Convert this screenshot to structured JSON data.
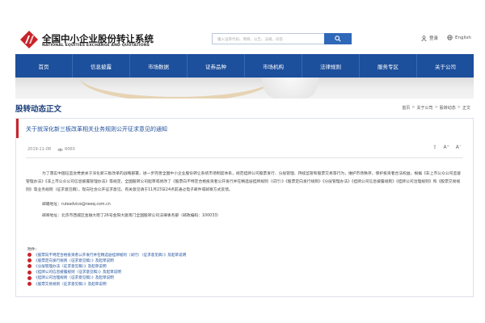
{
  "header": {
    "logo_cn": "全国中小企业股份转让系统",
    "logo_en": "NATIONAL EQUITIES EXCHANGE AND QUOTATIONS",
    "search_placeholder": "输入证券代码、简称、公告、法规、问答",
    "login_label": "登录",
    "english_label": "English"
  },
  "nav": {
    "items": [
      "首页",
      "信息披露",
      "市场数据",
      "证券品种",
      "市场机构",
      "法律规则",
      "服务专区",
      "关于公司"
    ]
  },
  "section": {
    "title": "股转动态正文",
    "breadcrumb": [
      "首页",
      "关于公司",
      "股转动态",
      "正文"
    ]
  },
  "article": {
    "title": "关于就深化新三板改革相关业务规则公开征求意见的通知",
    "date": "2019-11-08",
    "views": "6060",
    "tools": [
      "⇪",
      "A⁺",
      "A⁻"
    ],
    "paragraph1": "为了落实中国证监会党委关于深化新三板改革的战略部署，进一步完善全国中小企业股份转让系统市场制度体系，规范挂牌公司股票发行、分层管理、持续监管和股票交易等行为，维护市场秩序，保护投资者合法权益，根据《非上市公众公司监督管理办法》《非上市公众公司信息披露管理办法》等规定，全国股转公司起草或修改了《股票向不特定合格投资者公开发行并在精选层挂牌规则（试行）》《股票定向发行规则》《分层管理办法》《挂牌公司信息披露规则》《挂牌公司治理规则》和《股票交易规则》等业务规则（征求意见稿），现向社会公开征求意见。有关意见请于11月23日24点前通过电子邮件或邮寄方式反馈。",
    "email_line": "邮箱地址：ruleadvice@neeq.com.cn",
    "mail_line": "邮寄地址：北京市西城区金融大街丁26号金阳大厦南门全国股转公司法律事务部（邮政编码：100033）",
    "attachments_label": "附件：",
    "attachments": [
      "《股票向不特定合格投资者公开发行并在精选层挂牌规则（试行）（征求意见稿）》及起草说明",
      "《股票定向发行规则（征求意见稿）》及起草说明",
      "《分层管理办法（征求意见稿）》及起草说明",
      "《挂牌公司信息披露规则（征求意见稿）》及起草说明",
      "《挂牌公司治理规则（征求意见稿）》及起草说明",
      "《股票交易规则（征求意见稿）》及起草说明"
    ]
  },
  "colors": {
    "nav_bg": "#1c4f9c",
    "accent_red": "#c9242b",
    "link_blue": "#1c4f9c",
    "title_navy": "#1c3f7a"
  },
  "icons": {
    "logo": "neeq-logo-icon",
    "search": "search-icon",
    "user": "user-icon",
    "globe": "globe-icon",
    "calendar": "calendar-icon",
    "eye": "eye-icon",
    "share": "share-icon",
    "attachment": "attachment-icon"
  }
}
